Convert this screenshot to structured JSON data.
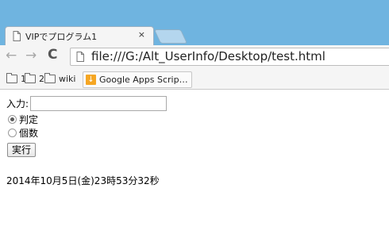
{
  "browser": {
    "tab": {
      "title": "VIPでプログラム1",
      "close_glyph": "×",
      "favicon_icon": "page-icon"
    },
    "toolbar": {
      "back_glyph": "←",
      "forward_glyph": "→",
      "reload_glyph": "C",
      "url": "file:///G:/Alt_UserInfo/Desktop/test.html"
    },
    "bookmarks": [
      {
        "label": "1",
        "icon": "folder-icon"
      },
      {
        "label": "2",
        "icon": "folder-icon"
      },
      {
        "label": "wiki",
        "icon": "folder-icon"
      },
      {
        "label": "Google Apps Scrip…",
        "icon": "apps-script-icon"
      }
    ]
  },
  "page": {
    "input_label": "入力:",
    "input_value": "",
    "radios": [
      {
        "label": "判定",
        "checked": true
      },
      {
        "label": "個数",
        "checked": false
      }
    ],
    "exec_button": "実行",
    "output_text": "2014年10月5日(金)23時53分32秒"
  },
  "colors": {
    "tabstrip": "#6fb4e0",
    "toolbar": "#f5f5f5",
    "apps_script_icon": "#f5a623"
  }
}
